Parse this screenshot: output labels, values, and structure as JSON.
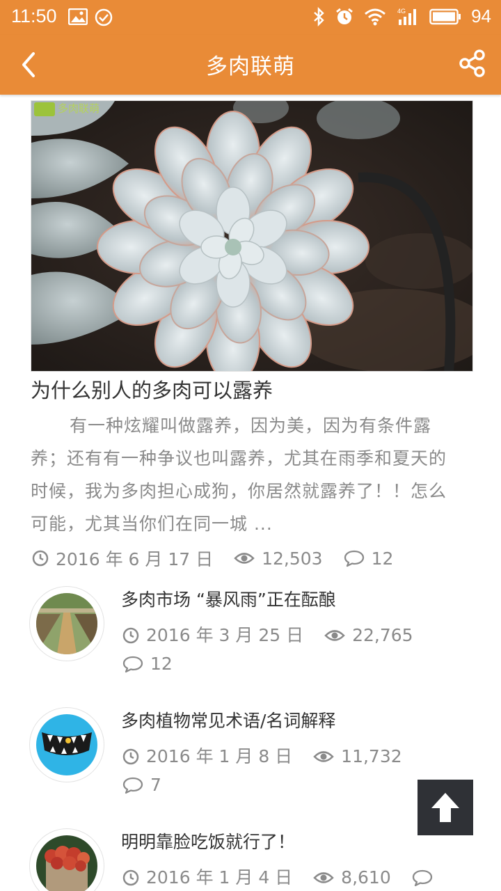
{
  "status_bar": {
    "time": "11:50",
    "battery": "94",
    "left_icons": [
      "image-icon",
      "check-circle-icon"
    ],
    "right_icons": [
      "bluetooth-icon",
      "alarm-icon",
      "wifi-icon",
      "signal-4g-icon",
      "battery-icon"
    ]
  },
  "app_bar": {
    "title": "多肉联萌",
    "back_icon": "chevron-left-icon",
    "share_icon": "share-icon"
  },
  "featured": {
    "image_watermark": "多肉联萌",
    "title": "为什么别人的多肉可以露养",
    "excerpt": "有一种炫耀叫做露养，因为美，因为有条件露养；还有有一种争议也叫露养，尤其在雨季和夏天的时候，我为多肉担心成狗，你居然就露养了！！怎么可能，尤其当你们在同一城 ...",
    "date": "2016 年 6 月 17 日",
    "views": "12,503",
    "comments": "12"
  },
  "articles": [
    {
      "title": "多肉市场 “暴风雨”正在酝酿",
      "date": "2016 年 3 月 25 日",
      "views": "22,765",
      "comments": "12"
    },
    {
      "title": "多肉植物常见术语/名词解释",
      "date": "2016 年 1 月 8 日",
      "views": "11,732",
      "comments": "7"
    },
    {
      "title": "明明靠脸吃饭就行了！",
      "date": "2016 年 1 月 4 日",
      "views": "8,610",
      "comments": ""
    }
  ],
  "back_to_top_icon": "arrow-up-icon",
  "colors": {
    "accent": "#e98b37",
    "text": "#333333",
    "muted": "#8a8a8a",
    "back_top_bg": "#2f3136"
  }
}
